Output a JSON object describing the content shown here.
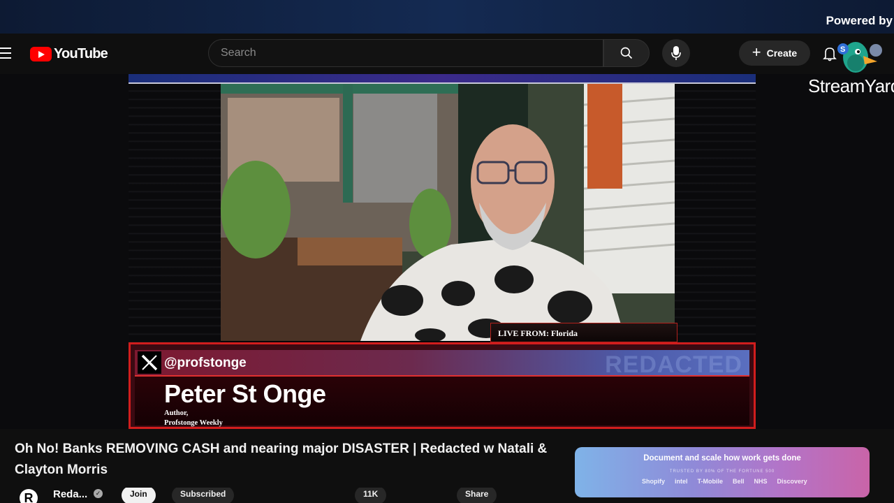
{
  "overlay": {
    "powered_by": "Powered by",
    "brand": "StreamYard"
  },
  "youtube": {
    "logo_text": "YouTube",
    "search": {
      "placeholder": "Search"
    },
    "create_label": "Create"
  },
  "video": {
    "live_from": "LIVE FROM:  Florida",
    "x_handle": "@profstonge",
    "watermark": "REDACTED",
    "guest_name": "Peter St Onge",
    "guest_role_line1": "Author,",
    "guest_role_line2": "Profstonge Weekly"
  },
  "below": {
    "title": "Oh No! Banks REMOVING CASH and nearing major DISASTER | Redacted w Natali & Clayton Morris",
    "channel_name": "Reda...",
    "join_label": "Join",
    "subscribe_label": "Subscribed",
    "likes": "11K",
    "share_label": "Share"
  },
  "ad": {
    "headline": "Document and scale how work gets done",
    "subline": "TRUSTED BY 80% OF THE FORTUNE 500",
    "logos": [
      "Shopify",
      "intel",
      "T-Mobile",
      "Bell",
      "NHS",
      "Discovery"
    ]
  },
  "icons": [
    "menu-icon",
    "youtube-play-icon",
    "search-icon",
    "microphone-icon",
    "plus-icon",
    "bell-icon",
    "x-logo-icon",
    "verified-icon"
  ]
}
